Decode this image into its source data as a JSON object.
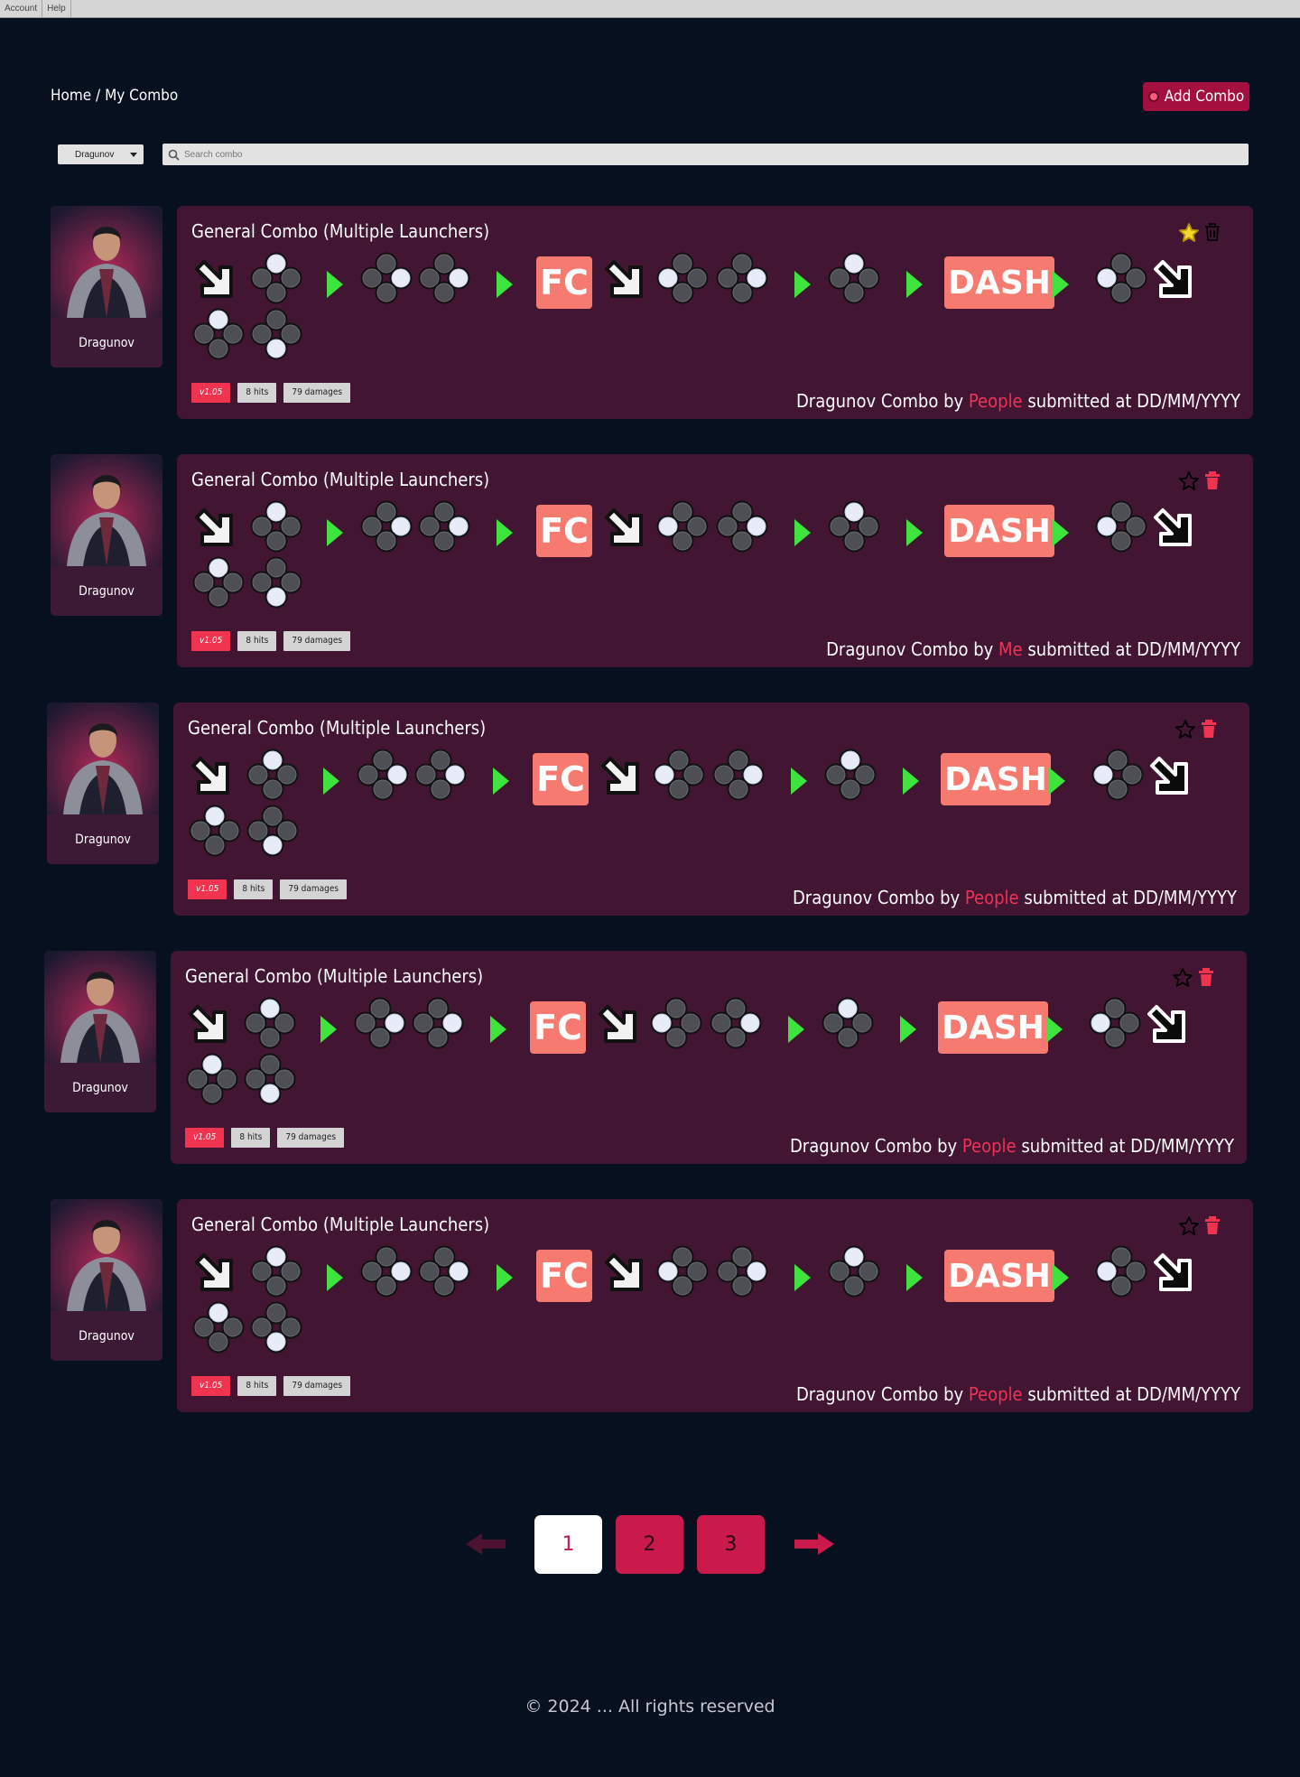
{
  "menubar": {
    "items": [
      "Account",
      "Help"
    ]
  },
  "breadcrumb": {
    "home": "Home",
    "separator": "/",
    "current": "My Combo"
  },
  "add_button": {
    "label": "Add Combo"
  },
  "filters": {
    "character": "Dragunov",
    "search_placeholder": "Search combo"
  },
  "sequence": [
    {
      "kind": "arrow",
      "dir": "down-right",
      "style": "light"
    },
    {
      "kind": "buttons",
      "lit": [
        1
      ]
    },
    {
      "kind": "next"
    },
    {
      "kind": "buttons",
      "lit": [
        2
      ]
    },
    {
      "kind": "buttons",
      "lit": [
        2
      ]
    },
    {
      "kind": "next"
    },
    {
      "kind": "label",
      "text": "FC"
    },
    {
      "kind": "arrow",
      "dir": "down-right",
      "style": "light"
    },
    {
      "kind": "buttons",
      "lit": [
        3
      ]
    },
    {
      "kind": "buttons",
      "lit": [
        2
      ]
    },
    {
      "kind": "next"
    },
    {
      "kind": "buttons",
      "lit": [
        1
      ]
    },
    {
      "kind": "next"
    },
    {
      "kind": "label",
      "text": "DASH"
    },
    {
      "kind": "next"
    },
    {
      "kind": "buttons",
      "lit": [
        3
      ]
    },
    {
      "kind": "arrow",
      "dir": "down-right",
      "style": "dark"
    },
    {
      "kind": "buttons",
      "lit": [
        1
      ]
    },
    {
      "kind": "buttons",
      "lit": [
        4
      ]
    }
  ],
  "colors": {
    "background": "#07101f",
    "card": "#421532",
    "accent": "#c91a4b",
    "tag_version": "#f0334f",
    "next_arrow": "#3ee33e",
    "label_box": "#f77a70",
    "star_filled": "#f5d82a",
    "trash_active": "#f0334f"
  },
  "combos": [
    {
      "character": "Dragunov",
      "title": "General Combo (Multiple Launchers)",
      "favorite": true,
      "trash": "outline",
      "version": "v1.05",
      "hits": "8 hits",
      "damage": "79 damages",
      "prefix": "Dragunov Combo by",
      "author": "People",
      "suffix": "submitted at DD/MM/YYYY"
    },
    {
      "character": "Dragunov",
      "title": "General Combo (Multiple Launchers)",
      "favorite": false,
      "trash": "filled",
      "version": "v1.05",
      "hits": "8 hits",
      "damage": "79 damages",
      "prefix": "Dragunov Combo by",
      "author": "Me",
      "suffix": "submitted at DD/MM/YYYY"
    },
    {
      "character": "Dragunov",
      "title": "General Combo (Multiple Launchers)",
      "favorite": false,
      "trash": "filled",
      "version": "v1.05",
      "hits": "8 hits",
      "damage": "79 damages",
      "prefix": "Dragunov Combo by",
      "author": "People",
      "suffix": "submitted at DD/MM/YYYY"
    },
    {
      "character": "Dragunov",
      "title": "General Combo (Multiple Launchers)",
      "favorite": false,
      "trash": "filled",
      "version": "v1.05",
      "hits": "8 hits",
      "damage": "79 damages",
      "prefix": "Dragunov Combo by",
      "author": "People",
      "suffix": "submitted at DD/MM/YYYY"
    },
    {
      "character": "Dragunov",
      "title": "General Combo (Multiple Launchers)",
      "favorite": false,
      "trash": "filled",
      "version": "v1.05",
      "hits": "8 hits",
      "damage": "79 damages",
      "prefix": "Dragunov Combo by",
      "author": "People",
      "suffix": "submitted at DD/MM/YYYY"
    }
  ],
  "pagination": {
    "pages": [
      "1",
      "2",
      "3"
    ],
    "current": "1"
  },
  "footer": {
    "copyright": "© 2024 ... All rights reserved"
  }
}
